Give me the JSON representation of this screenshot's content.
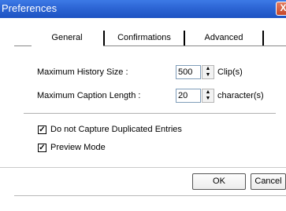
{
  "window": {
    "title": "Preferences",
    "close_glyph": "X"
  },
  "tabs": [
    {
      "label": "General",
      "active": true
    },
    {
      "label": "Confirmations",
      "active": false
    },
    {
      "label": "Advanced",
      "active": false
    }
  ],
  "general": {
    "max_history_label": "Maximum History Size :",
    "max_history_value": "500",
    "max_history_unit": "Clip(s)",
    "max_caption_label": "Maximum Caption Length :",
    "max_caption_value": "20",
    "max_caption_unit": "character(s)",
    "no_duplicates_label": "Do not Capture Duplicated Entries",
    "no_duplicates_checked": true,
    "preview_mode_label": "Preview Mode",
    "preview_mode_checked": true,
    "check_glyph": "✓"
  },
  "buttons": {
    "ok_label": "OK",
    "cancel_label": "Cancel"
  },
  "spin_glyphs": {
    "up": "▲",
    "down": "▼"
  },
  "colors": {
    "title_bar": "#2e67d6",
    "close_button": "#c6472a"
  }
}
